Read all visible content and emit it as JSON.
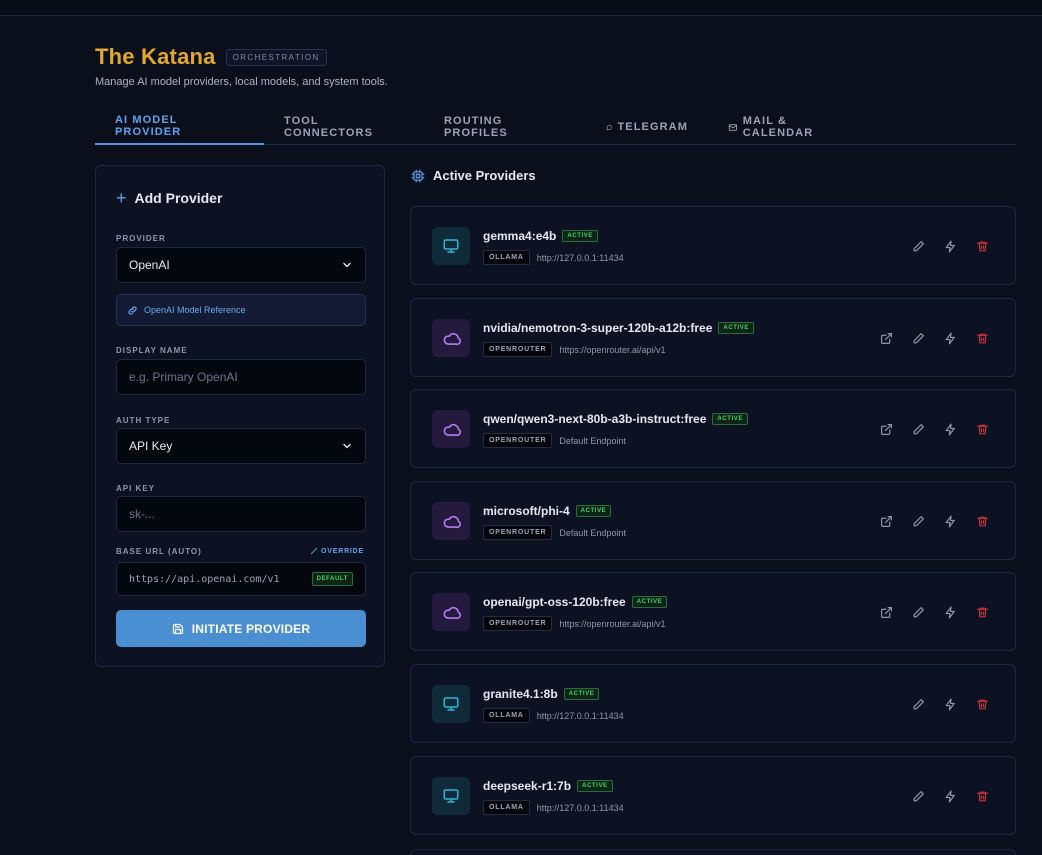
{
  "header": {
    "title": "The Katana",
    "badge": "ORCHESTRATION",
    "subtitle": "Manage AI model providers, local models, and system tools."
  },
  "tabs": [
    {
      "label": "AI MODEL PROVIDER",
      "active": true,
      "icon": ""
    },
    {
      "label": "TOOL CONNECTORS",
      "active": false,
      "icon": ""
    },
    {
      "label": "ROUTING PROFILES",
      "active": false,
      "icon": ""
    },
    {
      "label": "TELEGRAM",
      "active": false,
      "icon": "chat-bubble-icon"
    },
    {
      "label": "MAIL & CALENDAR",
      "active": false,
      "icon": "mail-icon"
    }
  ],
  "form": {
    "title": "Add Provider",
    "provider_label": "PROVIDER",
    "provider_value": "OpenAI",
    "reference_link": "OpenAI Model Reference",
    "display_name_label": "DISPLAY NAME",
    "display_name_placeholder": "e.g. Primary OpenAI",
    "auth_type_label": "AUTH TYPE",
    "auth_type_value": "API Key",
    "api_key_label": "API KEY",
    "api_key_placeholder": "sk-...",
    "base_url_label": "BASE URL (AUTO)",
    "override_label": "OVERRIDE",
    "base_url_value": "https://api.openai.com/v1",
    "default_badge": "DEFAULT",
    "submit_label": "INITIATE PROVIDER"
  },
  "providers_section": {
    "title": "Active Providers",
    "providers": [
      {
        "name": "gemma4:e4b",
        "status": "ACTIVE",
        "type": "OLLAMA",
        "endpoint": "http://127.0.0.1:11434",
        "kind": "local",
        "external_link": false
      },
      {
        "name": "nvidia/nemotron-3-super-120b-a12b:free",
        "status": "ACTIVE",
        "type": "OPENROUTER",
        "endpoint": "https://openrouter.ai/api/v1",
        "kind": "cloud",
        "external_link": true
      },
      {
        "name": "qwen/qwen3-next-80b-a3b-instruct:free",
        "status": "ACTIVE",
        "type": "OPENROUTER",
        "endpoint": "Default Endpoint",
        "kind": "cloud",
        "external_link": true
      },
      {
        "name": "microsoft/phi-4",
        "status": "ACTIVE",
        "type": "OPENROUTER",
        "endpoint": "Default Endpoint",
        "kind": "cloud",
        "external_link": true
      },
      {
        "name": "openai/gpt-oss-120b:free",
        "status": "ACTIVE",
        "type": "OPENROUTER",
        "endpoint": "https://openrouter.ai/api/v1",
        "kind": "cloud",
        "external_link": true
      },
      {
        "name": "granite4.1:8b",
        "status": "ACTIVE",
        "type": "OLLAMA",
        "endpoint": "http://127.0.0.1:11434",
        "kind": "local",
        "external_link": false
      },
      {
        "name": "deepseek-r1:7b",
        "status": "ACTIVE",
        "type": "OLLAMA",
        "endpoint": "http://127.0.0.1:11434",
        "kind": "local",
        "external_link": false
      }
    ]
  },
  "colors": {
    "background": "#0b0f1c",
    "accent": "#4b8fd3",
    "title": "#e3a82a",
    "active_green": "#3fd66a",
    "delete_red": "#c8303a",
    "local_icon": "#2bb8d8",
    "cloud_icon": "#b47cf0"
  }
}
